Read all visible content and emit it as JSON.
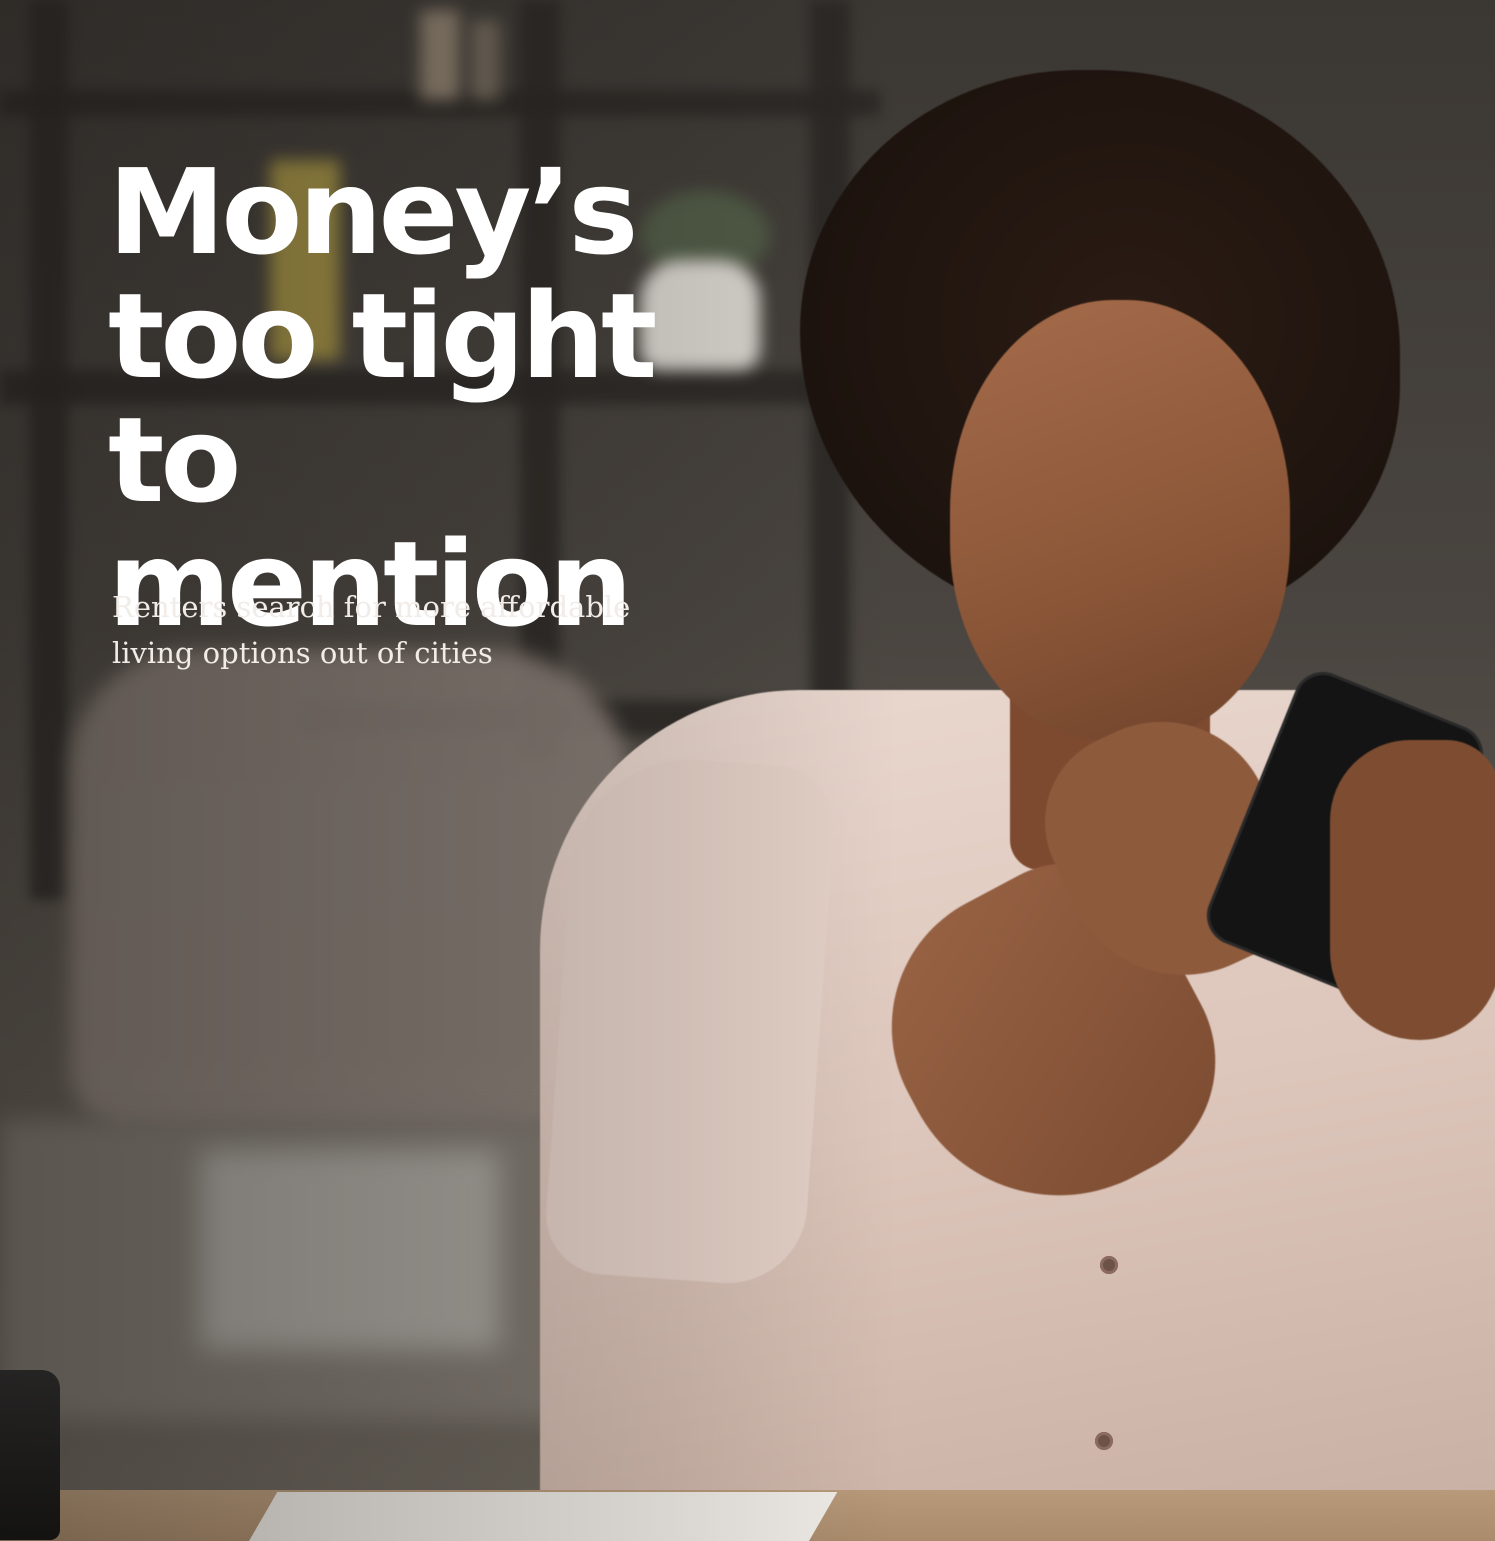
{
  "article": {
    "headline": "Money’s too tight to mention",
    "subheadline": "Renters search for more affordable living options out of cities"
  },
  "photo": {
    "subject": "woman-looking-at-phone"
  },
  "colors": {
    "headline_text": "#ffffff",
    "subheadline_text": "#f1ece7",
    "shirt": "#ead8cf",
    "background": "#3b3733"
  }
}
